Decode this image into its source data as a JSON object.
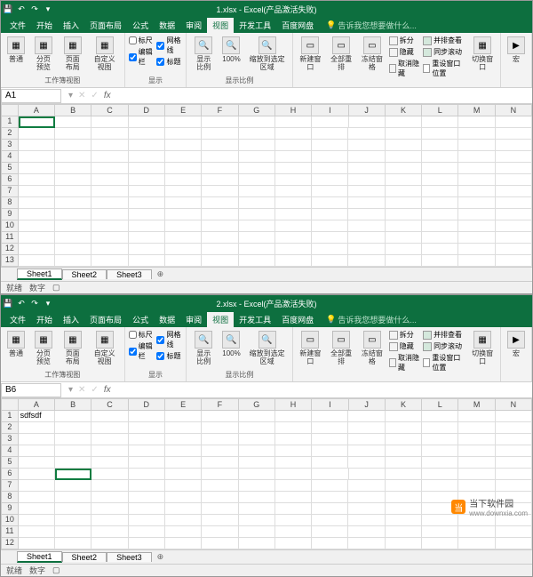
{
  "windows": [
    {
      "title": "1.xlsx - Excel(产品激活失败)",
      "active_cell": "A1",
      "active_cell_pos": {
        "row": 1,
        "col": 0
      },
      "cells": {}
    },
    {
      "title": "2.xlsx - Excel(产品激活失败)",
      "active_cell": "B6",
      "active_cell_pos": {
        "row": 6,
        "col": 1
      },
      "cells": {
        "1_0": "sdfsdf"
      }
    }
  ],
  "menu": {
    "items": [
      "文件",
      "开始",
      "插入",
      "页面布局",
      "公式",
      "数据",
      "审阅",
      "视图",
      "开发工具",
      "百度网盘"
    ],
    "active": "视图",
    "tell_me": "告诉我您想要做什么..."
  },
  "ribbon": {
    "group1_label": "工作簿视图",
    "views": [
      "普通",
      "分页预览",
      "页面布局",
      "自定义视图"
    ],
    "group2_label": "显示",
    "checks": [
      {
        "label": "标尺",
        "checked": false
      },
      {
        "label": "编辑栏",
        "checked": true
      },
      {
        "label": "网格线",
        "checked": true
      },
      {
        "label": "标题",
        "checked": true
      }
    ],
    "group3_label": "显示比例",
    "zoom_btns": [
      "显示比例",
      "100%",
      "缩放到选定区域"
    ],
    "group4_btns": [
      "新建窗口",
      "全部重排",
      "冻结窗格"
    ],
    "group4_opts": [
      "拆分",
      "隐藏",
      "取消隐藏"
    ],
    "group5_opts": [
      "并排查看",
      "同步滚动",
      "重设窗口位置"
    ],
    "switch_win": "切换窗口",
    "macros": "宏"
  },
  "columns": [
    "A",
    "B",
    "C",
    "D",
    "E",
    "F",
    "G",
    "H",
    "I",
    "J",
    "K",
    "L",
    "M",
    "N"
  ],
  "row_count_1": 13,
  "row_count_2": 12,
  "sheets": [
    "Sheet1",
    "Sheet2",
    "Sheet3"
  ],
  "active_sheet": "Sheet1",
  "status": [
    "就绪",
    "数字"
  ],
  "watermark": {
    "name": "当下软件园",
    "url": "www.downxia.com"
  }
}
